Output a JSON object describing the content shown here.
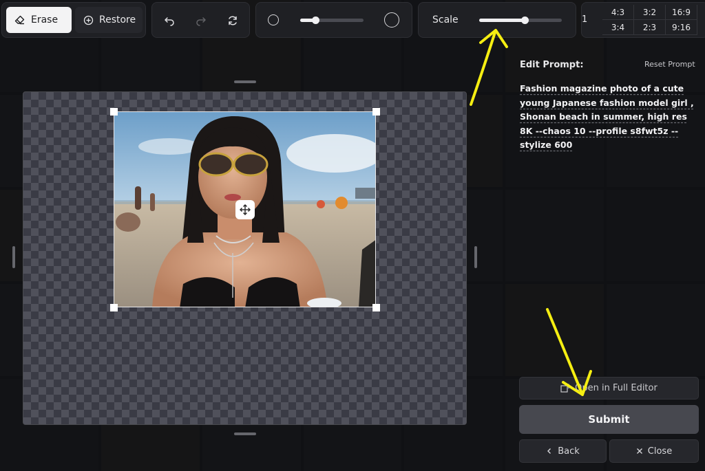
{
  "toolbar": {
    "erase_label": "Erase",
    "restore_label": "Restore",
    "brush_size": 0.24,
    "scale_label": "Scale",
    "scale_value": 0.55,
    "ratio_lead": "1",
    "ratios": [
      "4:3",
      "3:2",
      "16:9",
      "3:4",
      "2:3",
      "9:16"
    ]
  },
  "panel": {
    "title": "Edit Prompt:",
    "reset_label": "Reset Prompt",
    "prompt": "Fashion magazine photo of a cute young Japanese fashion model girl , Shonan beach in summer, high res 8K --chaos 10 --profile s8fwt5z --stylize 600",
    "full_editor_label": "Open in Full Editor",
    "submit_label": "Submit",
    "back_label": "Back",
    "close_label": "Close"
  },
  "colors": {
    "annotation_arrow": "#f5ee12",
    "background": "#16171b",
    "submit_bg": "#47484f"
  }
}
